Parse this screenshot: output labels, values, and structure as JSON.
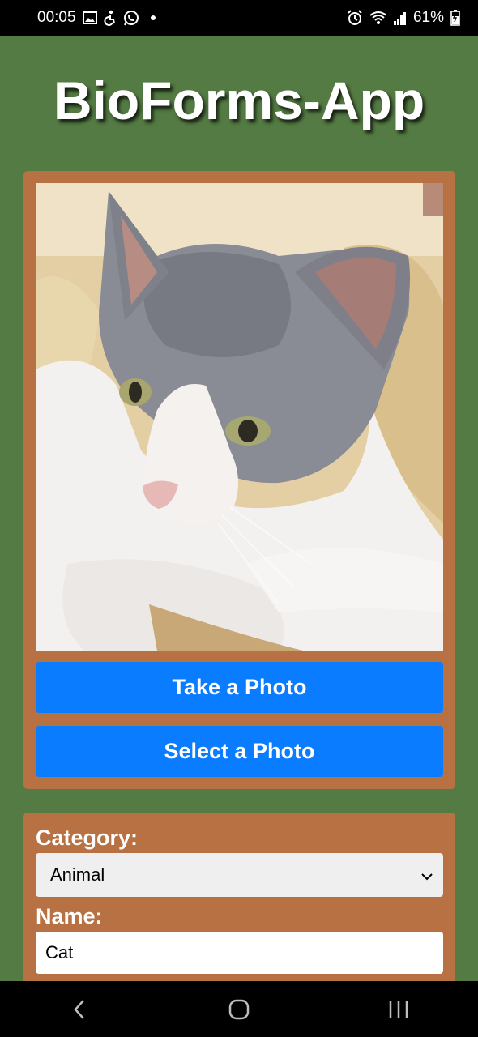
{
  "status_bar": {
    "time": "00:05",
    "battery": "61%",
    "icons": [
      "image-icon",
      "accessibility-icon",
      "whatsapp-icon",
      "notification-dot-icon",
      "alarm-icon",
      "wifi-icon",
      "signal-icon",
      "battery-charging-icon"
    ]
  },
  "app": {
    "title": "BioForms-App"
  },
  "photo": {
    "alt": "Photo of a grey and white cat"
  },
  "buttons": {
    "take_photo": "Take a Photo",
    "select_photo": "Select a Photo"
  },
  "form": {
    "category_label": "Category:",
    "category_value": "Animal",
    "name_label": "Name:",
    "name_value": "Cat"
  },
  "nav_bar": {
    "icons": [
      "back-icon",
      "home-icon",
      "recent-apps-icon"
    ]
  },
  "colors": {
    "background": "#547b43",
    "card": "#b87143",
    "button": "#0a7cff"
  }
}
